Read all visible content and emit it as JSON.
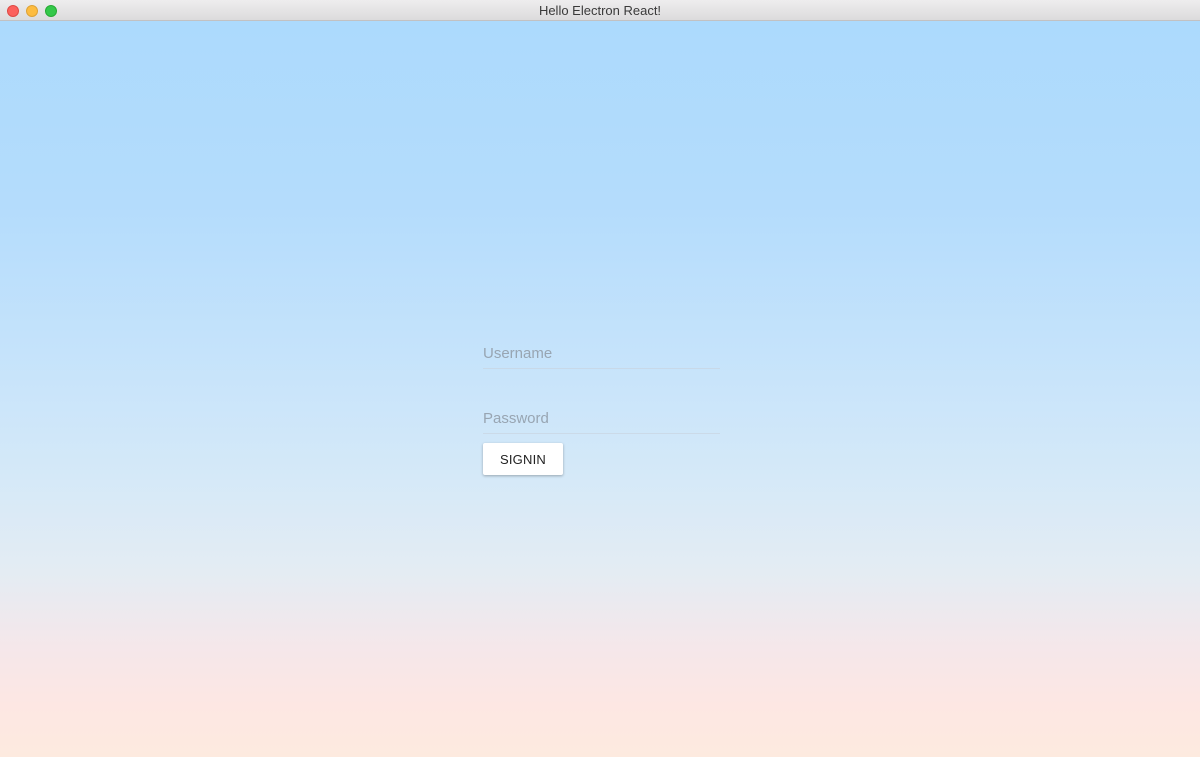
{
  "window": {
    "title": "Hello Electron React!"
  },
  "login_form": {
    "username": {
      "placeholder": "Username",
      "value": ""
    },
    "password": {
      "placeholder": "Password",
      "value": ""
    },
    "signin_label": "SIGNIN"
  }
}
